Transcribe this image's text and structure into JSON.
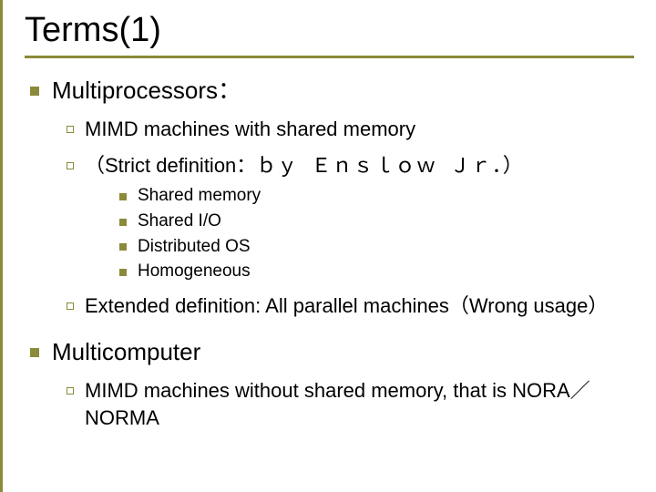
{
  "title": "Terms(1)",
  "sections": [
    {
      "heading": "Multiprocessors：",
      "items": [
        {
          "text": "MIMD machines with shared memory"
        },
        {
          "text": "（Strict definition：",
          "suffix_mono": "ｂｙ Ｅｎｓｌｏｗ Ｊｒ．）",
          "sub": [
            "Shared memory",
            "Shared I/O",
            "Distributed OS",
            "Homogeneous"
          ]
        },
        {
          "text": "Extended definition: All parallel machines（Wrong usage）"
        }
      ]
    },
    {
      "heading": "Multicomputer",
      "items": [
        {
          "text": "MIMD machines without shared memory, that is NORA／NORMA"
        }
      ]
    }
  ]
}
